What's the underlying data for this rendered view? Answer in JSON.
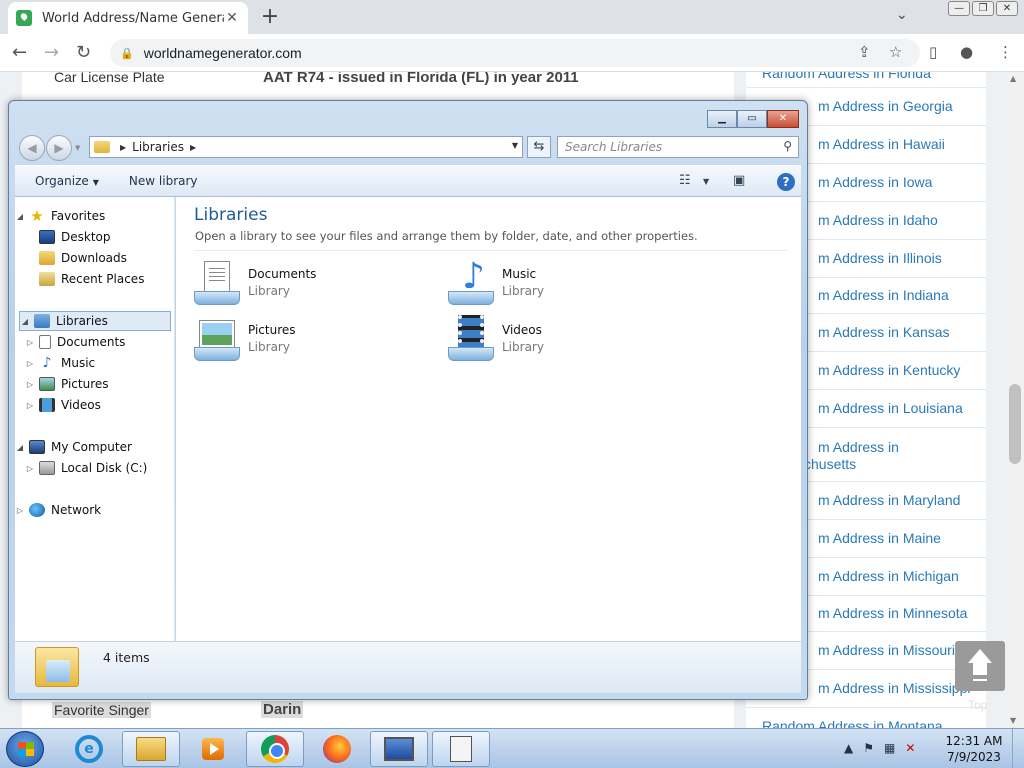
{
  "browser": {
    "tab_title": "World Address/Name Generator",
    "tab_close": "✕",
    "new_tab": "+",
    "url": "worldnamegenerator.com"
  },
  "webpage": {
    "rows": [
      {
        "label": "Car License Plate",
        "value": "AAT R74 - issued in Florida (FL) in year 2011"
      },
      {
        "label": "Favorite Singer",
        "value": "Darin"
      }
    ],
    "sidebar_links": [
      "Random Address in Florida",
      "m Address in Georgia",
      "m Address in Hawaii",
      "m Address in Iowa",
      "m Address in Idaho",
      "m Address in Illinois",
      "m Address in Indiana",
      "m Address in Kansas",
      "m Address in Kentucky",
      "m Address in Louisiana",
      "m Address in",
      "chusetts",
      "m Address in Maryland",
      "m Address in Maine",
      "m Address in Michigan",
      "m Address in Minnesota",
      "m Address in Missouri",
      "m Address in Mississippi",
      "Random Address in Montana"
    ],
    "top_label": "Top"
  },
  "explorer": {
    "address_crumb": "Libraries",
    "search_placeholder": "Search Libraries",
    "commands": {
      "organize": "Organize",
      "new_library": "New library"
    },
    "nav": {
      "favorites": "Favorites",
      "desktop": "Desktop",
      "downloads": "Downloads",
      "recent_places": "Recent Places",
      "libraries": "Libraries",
      "documents": "Documents",
      "music": "Music",
      "pictures": "Pictures",
      "videos": "Videos",
      "my_computer": "My Computer",
      "local_disk": "Local Disk (C:)",
      "network": "Network"
    },
    "content": {
      "title": "Libraries",
      "subtitle": "Open a library to see your files and arrange them by folder, date, and other properties.",
      "libraries": [
        {
          "name": "Documents",
          "type": "Library"
        },
        {
          "name": "Music",
          "type": "Library"
        },
        {
          "name": "Pictures",
          "type": "Library"
        },
        {
          "name": "Videos",
          "type": "Library"
        }
      ]
    },
    "status": "4 items"
  },
  "taskbar": {
    "time": "12:31 AM",
    "date": "7/9/2023"
  }
}
